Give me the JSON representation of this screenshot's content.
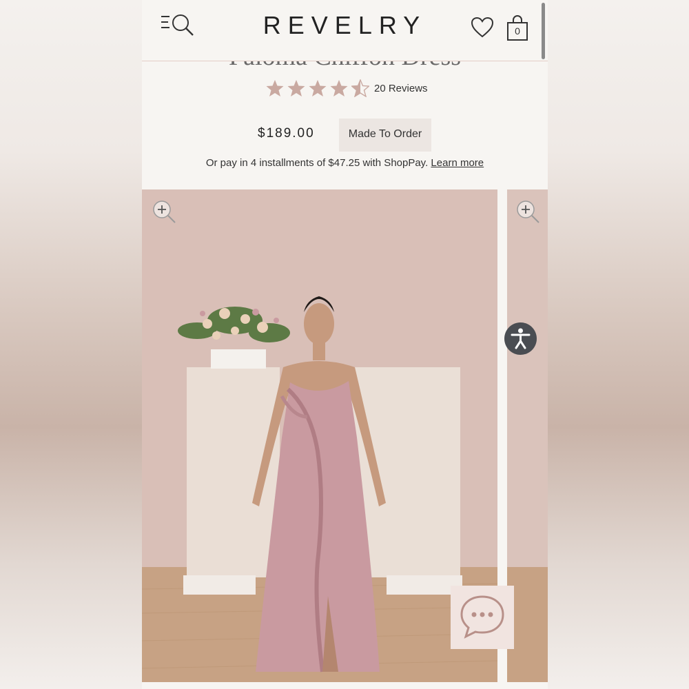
{
  "header": {
    "logo": "REVELRY",
    "cart_count": "0"
  },
  "product": {
    "title": "Paloma Chiffon Dress",
    "rating": 4.5,
    "rating_max": 5,
    "reviews": "20 Reviews",
    "price": "$189.00",
    "availability": "Made To Order",
    "installments_text": "Or pay in 4 installments of $47.25 with ShopPay.",
    "learn_more": "Learn more"
  },
  "icons": {
    "menu": "menu-search-icon",
    "wishlist": "heart-icon",
    "cart": "shopping-bag-icon",
    "zoom": "zoom-in-icon",
    "accessibility": "accessibility-icon",
    "chat": "chat-bubble-icon"
  },
  "colors": {
    "star": "#c9a9a1",
    "dress": "#c99aa0",
    "accent_line": "#e3cdc6"
  }
}
